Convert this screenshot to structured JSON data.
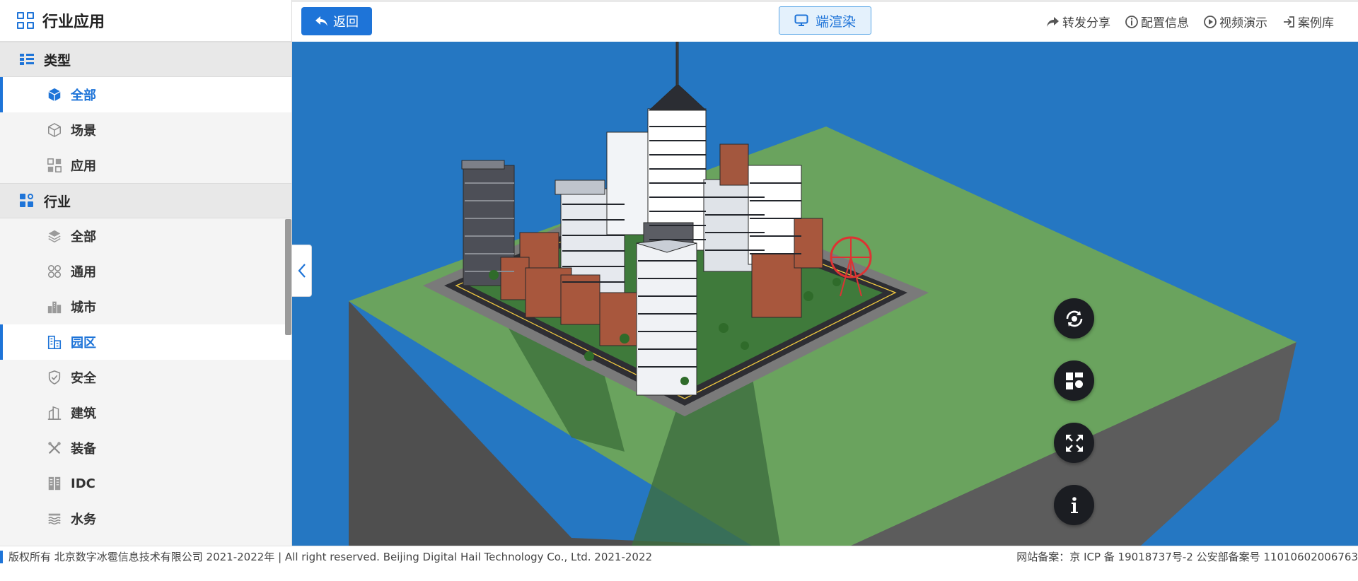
{
  "sidebar": {
    "title": "行业应用",
    "type_section": {
      "label": "类型",
      "items": [
        {
          "label": "全部",
          "icon": "cube-filled-icon",
          "active": true
        },
        {
          "label": "场景",
          "icon": "cube-outline-icon",
          "active": false
        },
        {
          "label": "应用",
          "icon": "app-grid-icon",
          "active": false
        }
      ]
    },
    "industry_section": {
      "label": "行业",
      "items": [
        {
          "label": "全部",
          "icon": "layers-icon",
          "active": false
        },
        {
          "label": "通用",
          "icon": "grid-circles-icon",
          "active": false
        },
        {
          "label": "城市",
          "icon": "city-icon",
          "active": false
        },
        {
          "label": "园区",
          "icon": "park-buildings-icon",
          "active": true
        },
        {
          "label": "安全",
          "icon": "shield-check-icon",
          "active": false
        },
        {
          "label": "建筑",
          "icon": "building-icon",
          "active": false
        },
        {
          "label": "装备",
          "icon": "tools-icon",
          "active": false
        },
        {
          "label": "IDC",
          "icon": "server-rack-icon",
          "active": false
        },
        {
          "label": "水务",
          "icon": "water-icon",
          "active": false
        }
      ]
    }
  },
  "toolbar": {
    "back_label": "返回",
    "render_label": "端渲染",
    "actions": [
      {
        "label": "转发分享",
        "icon": "share-icon"
      },
      {
        "label": "配置信息",
        "icon": "info-icon"
      },
      {
        "label": "视频演示",
        "icon": "play-icon"
      },
      {
        "label": "案例库",
        "icon": "login-icon"
      }
    ]
  },
  "viewport": {
    "controls": [
      {
        "name": "rotate-view-button",
        "icon": "rotate-icon"
      },
      {
        "name": "layout-button",
        "icon": "layout-icon"
      },
      {
        "name": "fullscreen-button",
        "icon": "expand-icon"
      },
      {
        "name": "info-button",
        "icon": "info-i-icon"
      }
    ]
  },
  "footer": {
    "copyright": "版权所有 北京数字冰雹信息技术有限公司 2021-2022年 | All right reserved. Beijing Digital Hail Technology Co., Ltd. 2021-2022",
    "icp": "网站备案：京 ICP 备 19018737号-2 公安部备案号 11010602006763"
  },
  "colors": {
    "accent": "#1e74d8",
    "viewport_bg": "#2577c2",
    "ground_top": "#6aa35e",
    "ground_side": "#5a5a5a"
  }
}
